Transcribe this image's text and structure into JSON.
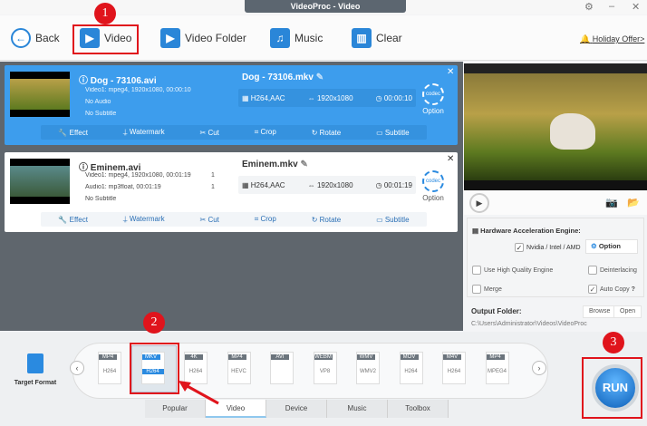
{
  "window": {
    "title": "VideoProc - Video"
  },
  "toolbar": {
    "back": "Back",
    "video": "Video",
    "video_folder": "Video Folder",
    "music": "Music",
    "clear": "Clear",
    "holiday": "Holiday Offer>"
  },
  "files": [
    {
      "name": "Dog - 73106.avi",
      "video": "Video1: mpeg4, 1920x1080, 00:00:10",
      "audio": "No Audio",
      "subtitle": "No Subtitle",
      "output": "Dog - 73106.mkv",
      "codec": "H264,AAC",
      "resolution": "1920x1080",
      "duration": "00:00:10",
      "option": "Option",
      "video_track": "",
      "audio_track": ""
    },
    {
      "name": "Eminem.avi",
      "video": "Video1: mpeg4, 1920x1080, 00:01:19",
      "audio": "Audio1: mp3float, 00:01:19",
      "subtitle": "No Subtitle",
      "output": "Eminem.mkv",
      "codec": "H264,AAC",
      "resolution": "1920x1080",
      "duration": "00:01:19",
      "option": "Option",
      "video_track": "1",
      "audio_track": "1"
    }
  ],
  "actions": [
    "Effect",
    "Watermark",
    "Cut",
    "Crop",
    "Rotate",
    "Subtitle"
  ],
  "settings": {
    "hw_title": "Hardware Acceleration Engine:",
    "nvidia": "Nvidia / Intel / AMD",
    "option": "Option",
    "high_quality": "Use High Quality Engine",
    "deinterlacing": "Deinterlacing",
    "merge": "Merge",
    "auto_copy": "Auto Copy",
    "help": "?",
    "output_folder": "Output Folder:",
    "browse": "Browse",
    "open": "Open",
    "path": "C:\\Users\\Administrator\\Videos\\VideoProc"
  },
  "formats": [
    {
      "tag": "MP4",
      "sub": "H264"
    },
    {
      "tag": "MKV",
      "sub": "H264"
    },
    {
      "tag": "4K",
      "sub": "H264"
    },
    {
      "tag": "MP4",
      "sub": "HEVC"
    },
    {
      "tag": "AVI",
      "sub": ""
    },
    {
      "tag": "WEBM",
      "sub": "VP8"
    },
    {
      "tag": "WMV",
      "sub": "WMV2"
    },
    {
      "tag": "MOV",
      "sub": "H264"
    },
    {
      "tag": "M4V",
      "sub": "H264"
    },
    {
      "tag": "MP4",
      "sub": "MPEG4"
    }
  ],
  "target_format": "Target Format",
  "tabs": [
    "Popular",
    "Video",
    "Device",
    "Music",
    "Toolbox"
  ],
  "run": "RUN",
  "annotations": [
    "1",
    "2",
    "3"
  ],
  "colors": {
    "accent": "#3d9ded",
    "annotation": "#e0141c"
  }
}
